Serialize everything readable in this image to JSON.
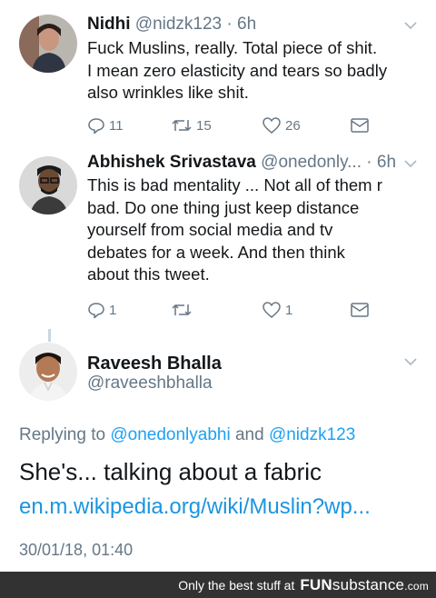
{
  "tweets": [
    {
      "name": "Nidhi",
      "handle": "@nidzk123",
      "time": "6h",
      "lines": [
        "Fuck Muslins, really. Total piece of shit.",
        "I mean zero elasticity and tears so badly",
        "also wrinkles like shit."
      ],
      "replies": "11",
      "retweets": "15",
      "likes": "26"
    },
    {
      "name": "Abhishek Srivastava",
      "handle": "@onedonly...",
      "time": "6h",
      "lines": [
        "This is bad mentality ... Not all of them r",
        "bad. Do one thing just keep distance",
        "yourself from social media and tv",
        "debates for a week. And then think",
        "about this tweet."
      ],
      "replies": "1",
      "retweets": "",
      "likes": "1"
    }
  ],
  "main": {
    "name": "Raveesh Bhalla",
    "handle": "@raveeshbhalla",
    "replying_prefix": "Replying to",
    "mention1": "@onedonlyabhi",
    "and": "and",
    "mention2": "@nidzk123",
    "text": "She's... talking about a fabric",
    "link": "en.m.wikipedia.org/wiki/Muslin?wp...",
    "timestamp": "30/01/18, 01:40"
  },
  "footer": {
    "text": "Only the best stuff at",
    "brand_fun": "FUN",
    "brand_sub": "substance",
    "brand_com": ".com"
  },
  "colors": {
    "link": "#1da1f2",
    "secondary": "#657786",
    "footer_bg": "#323232"
  },
  "icons": [
    "reply-icon",
    "retweet-icon",
    "like-icon",
    "direct-message-icon",
    "chevron-down-icon"
  ]
}
